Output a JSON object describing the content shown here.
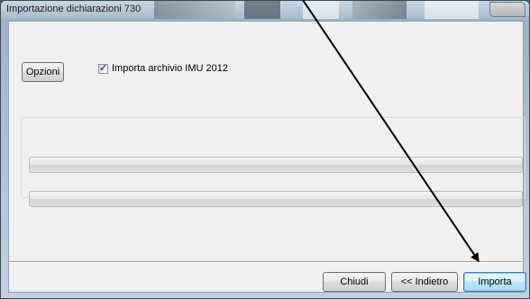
{
  "window": {
    "title": "Importazione dichiarazioni 730"
  },
  "options": {
    "button_label": "Opzioni"
  },
  "import_imu": {
    "label": "Importa archivio IMU 2012",
    "checked": true
  },
  "progress": [
    {
      "fraction": 0.0
    },
    {
      "fraction": 0.0
    }
  ],
  "footer": {
    "close_label": "Chiudi",
    "back_label": "<< Indietro",
    "import_label": "Importa"
  },
  "colors": {
    "annotation_arrow": "#000000",
    "progress_fill": "#06b025"
  }
}
